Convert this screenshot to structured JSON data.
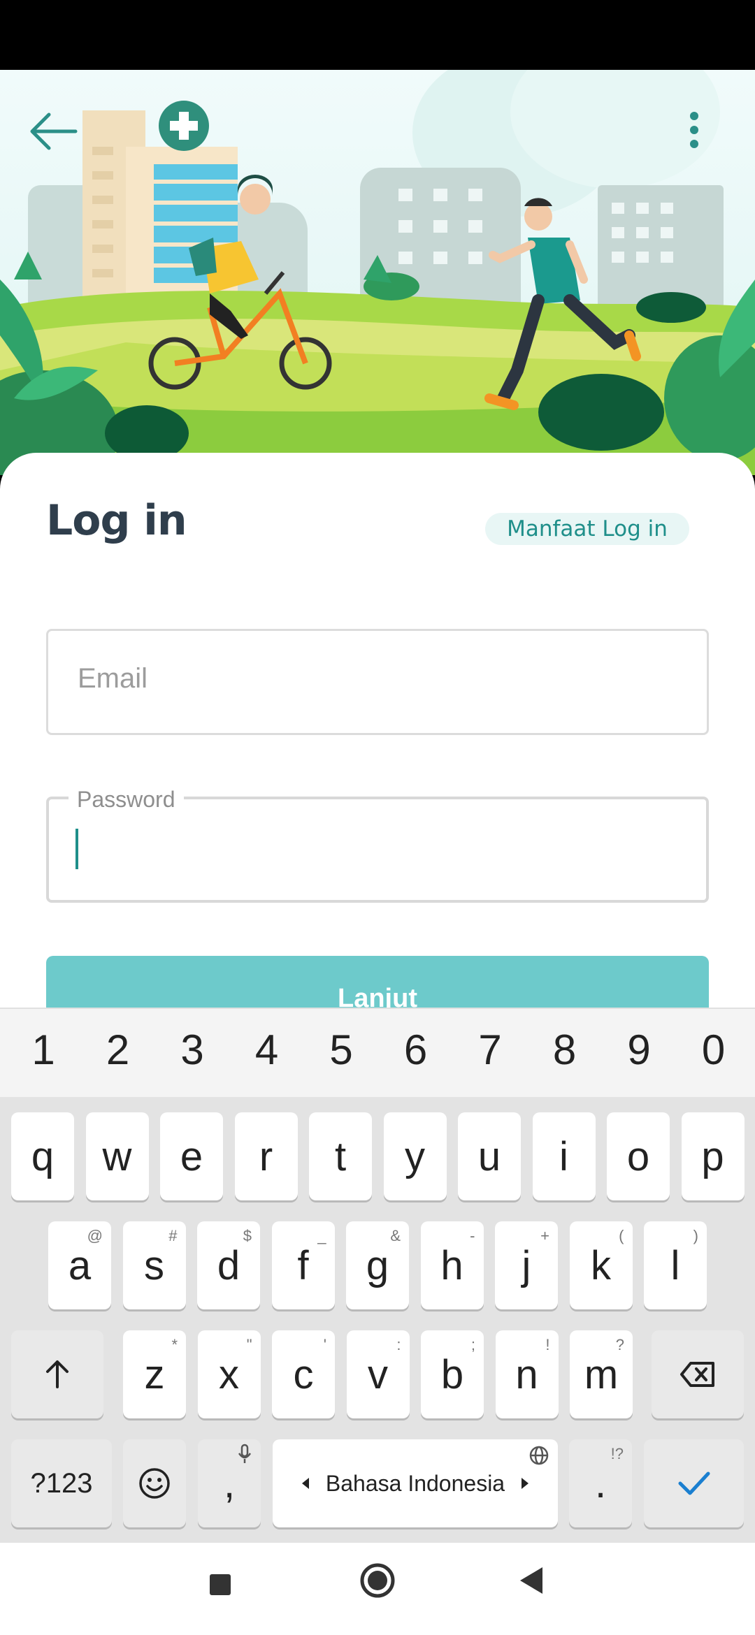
{
  "header": {
    "back_icon": "arrow-left-icon",
    "more_icon": "more-vertical-icon"
  },
  "login": {
    "title": "Log in",
    "benefit_link": "Manfaat Log in",
    "email_placeholder": "Email",
    "password_label": "Password",
    "continue_label": "Lanjut"
  },
  "keyboard": {
    "number_row": [
      "1",
      "2",
      "3",
      "4",
      "5",
      "6",
      "7",
      "8",
      "9",
      "0"
    ],
    "row1": [
      {
        "ch": "q",
        "hint": ""
      },
      {
        "ch": "w",
        "hint": ""
      },
      {
        "ch": "e",
        "hint": ""
      },
      {
        "ch": "r",
        "hint": ""
      },
      {
        "ch": "t",
        "hint": ""
      },
      {
        "ch": "y",
        "hint": ""
      },
      {
        "ch": "u",
        "hint": ""
      },
      {
        "ch": "i",
        "hint": ""
      },
      {
        "ch": "o",
        "hint": ""
      },
      {
        "ch": "p",
        "hint": ""
      }
    ],
    "row2": [
      {
        "ch": "a",
        "hint": "@"
      },
      {
        "ch": "s",
        "hint": "#"
      },
      {
        "ch": "d",
        "hint": "$"
      },
      {
        "ch": "f",
        "hint": "_"
      },
      {
        "ch": "g",
        "hint": "&"
      },
      {
        "ch": "h",
        "hint": "-"
      },
      {
        "ch": "j",
        "hint": "+"
      },
      {
        "ch": "k",
        "hint": "("
      },
      {
        "ch": "l",
        "hint": ")"
      }
    ],
    "row3": [
      {
        "ch": "z",
        "hint": "*"
      },
      {
        "ch": "x",
        "hint": "\""
      },
      {
        "ch": "c",
        "hint": "'"
      },
      {
        "ch": "v",
        "hint": ":"
      },
      {
        "ch": "b",
        "hint": ";"
      },
      {
        "ch": "n",
        "hint": "!"
      },
      {
        "ch": "m",
        "hint": "?"
      }
    ],
    "symbols_label": "?123",
    "comma_label": ",",
    "period_label": ".",
    "period_hint": "!?",
    "space_label": "Bahasa Indonesia",
    "shift_icon": "shift-arrow-icon",
    "backspace_icon": "backspace-icon",
    "emoji_icon": "emoji-icon",
    "mic_icon": "mic-icon",
    "globe_icon": "globe-icon",
    "enter_icon": "checkmark-icon"
  },
  "nav_bar": {
    "recents_icon": "square-icon",
    "home_icon": "circle-icon",
    "back_icon": "triangle-back-icon"
  },
  "colors": {
    "accent": "#1f8f8a",
    "button_disabled": "#6dcacb",
    "title": "#2f3e4c"
  }
}
